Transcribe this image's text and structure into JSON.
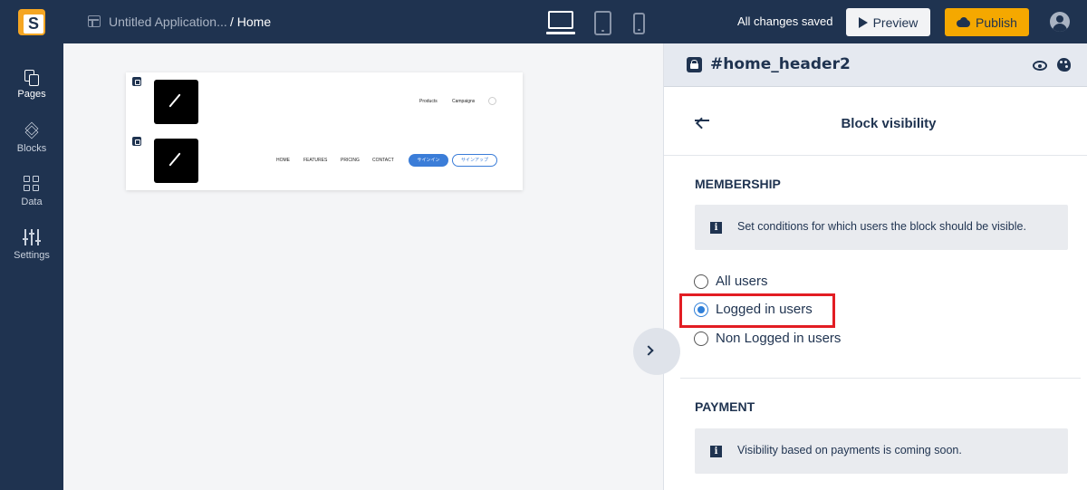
{
  "topbar": {
    "logo_letter": "S",
    "app_name": "Untitled Application...",
    "breadcrumb_page": "/ Home",
    "status": "All changes saved",
    "preview_label": "Preview",
    "publish_label": "Publish",
    "device_active": "desktop",
    "accent_color": "#f5a800",
    "bar_color": "#1f3350"
  },
  "leftnav": {
    "items": [
      {
        "label": "Pages",
        "icon": "pages-icon",
        "active": true
      },
      {
        "label": "Blocks",
        "icon": "layers-icon"
      },
      {
        "label": "Data",
        "icon": "grid-icon"
      },
      {
        "label": "Settings",
        "icon": "sliders-icon"
      }
    ]
  },
  "canvas": {
    "preview_row1_links": [
      "Products",
      "Campaigns"
    ],
    "preview_row2_links": [
      "HOME",
      "FEATURES",
      "PRICING",
      "CONTACT"
    ],
    "signin_label": "サインイン",
    "signup_label": "サインアップ"
  },
  "panel": {
    "block_id": "#home_header2",
    "title": "Block visibility",
    "membership": {
      "heading": "MEMBERSHIP",
      "info": "Set conditions for which users the block should be visible.",
      "options": [
        "All users",
        "Logged in users",
        "Non Logged in users"
      ],
      "selected": "Logged in users"
    },
    "payment": {
      "heading": "PAYMENT",
      "info": "Visibility based on payments is coming soon."
    }
  }
}
